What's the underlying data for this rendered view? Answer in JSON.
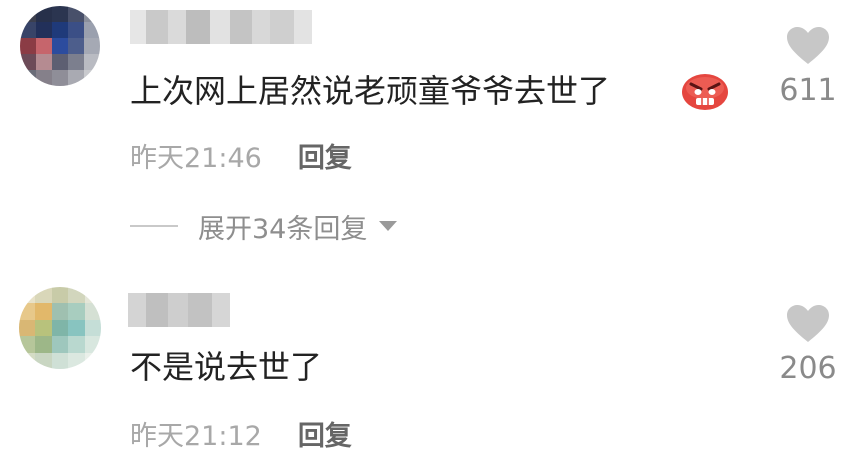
{
  "comments": [
    {
      "text": "上次网上居然说老顽童爷爷去世了",
      "emoji": "angry-face-emoji",
      "timestamp": "昨天21:46",
      "reply_label": "回复",
      "expand_label": "展开34条回复",
      "like_count": "611"
    },
    {
      "text": "不是说去世了",
      "timestamp": "昨天21:12",
      "reply_label": "回复",
      "like_count": "206"
    }
  ],
  "colors": {
    "text": "#222222",
    "meta": "#a8a8a8",
    "reply": "#666666",
    "expand": "#8e8e8e",
    "heart": "#c7c7c7",
    "emoji_red": "#e5463f"
  }
}
